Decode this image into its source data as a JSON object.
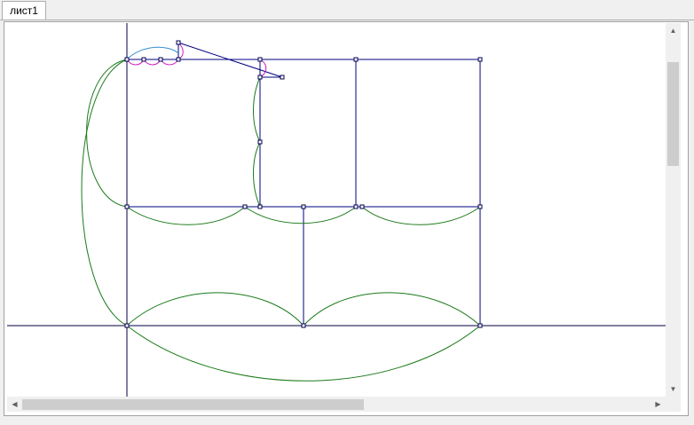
{
  "tabs": [
    {
      "label": "лист1",
      "active": true
    }
  ],
  "colors": {
    "construction": "#000080",
    "axis": "#000040",
    "curve_green": "#1a7a1a",
    "curve_blue": "#3a8fd0",
    "curve_magenta": "#d020c0"
  },
  "scrollbars": {
    "vertical": {
      "up_icon": "arrow-up-icon",
      "down_icon": "arrow-down-icon"
    },
    "horizontal": {
      "left_icon": "arrow-left-icon",
      "right_icon": "arrow-right-icon"
    }
  }
}
